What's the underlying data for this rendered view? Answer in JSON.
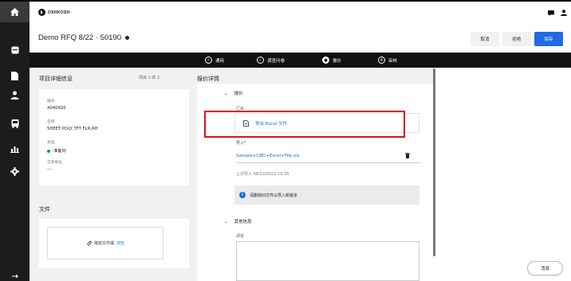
{
  "header": {
    "logo_text": "OSHKOSH",
    "title": "Demo RFQ 8/22 · 50190",
    "buttons": {
      "cancel": "取消",
      "reject": "拒绝",
      "save": "保存"
    }
  },
  "stepper": {
    "steps": [
      {
        "label": "通用",
        "marker": "✓",
        "state": "done"
      },
      {
        "label": "调查问卷",
        "marker": "✓",
        "state": "done"
      },
      {
        "label": "报价",
        "marker": "●",
        "state": "current"
      },
      {
        "label": "审核",
        "marker": "4",
        "state": "todo"
      }
    ]
  },
  "project": {
    "section_title": "项目详细信息",
    "pager": "项目 1 的 2",
    "fields": [
      {
        "label": "编号",
        "value": "4040920"
      },
      {
        "label": "名称",
        "value": "SHEET,POLY,TFT FLR,RH"
      },
      {
        "label": "状态",
        "value": "准备好"
      },
      {
        "label": "交货地址",
        "value": "---"
      }
    ],
    "status_color": "#1a9b3f"
  },
  "files": {
    "section_title": "文件",
    "drop_text": "拖放文件或",
    "browse_link": "浏览"
  },
  "quote": {
    "section_title": "报价详情",
    "group_title": "报价",
    "export_label": "汇出",
    "export_link": "导出 Excel 文件",
    "import_label": "导入*",
    "import_file": "Sample+CBD+Excel+File.xls",
    "last_import": "上次导入 08/22/2022 19:35",
    "info_text": "请删除旧文件以导入新版本",
    "other_title": "其他信息",
    "comment_label": "评论"
  },
  "chat": {
    "label": "消息"
  },
  "colors": {
    "accent": "#1f6be0",
    "highlight": "#e01010"
  }
}
